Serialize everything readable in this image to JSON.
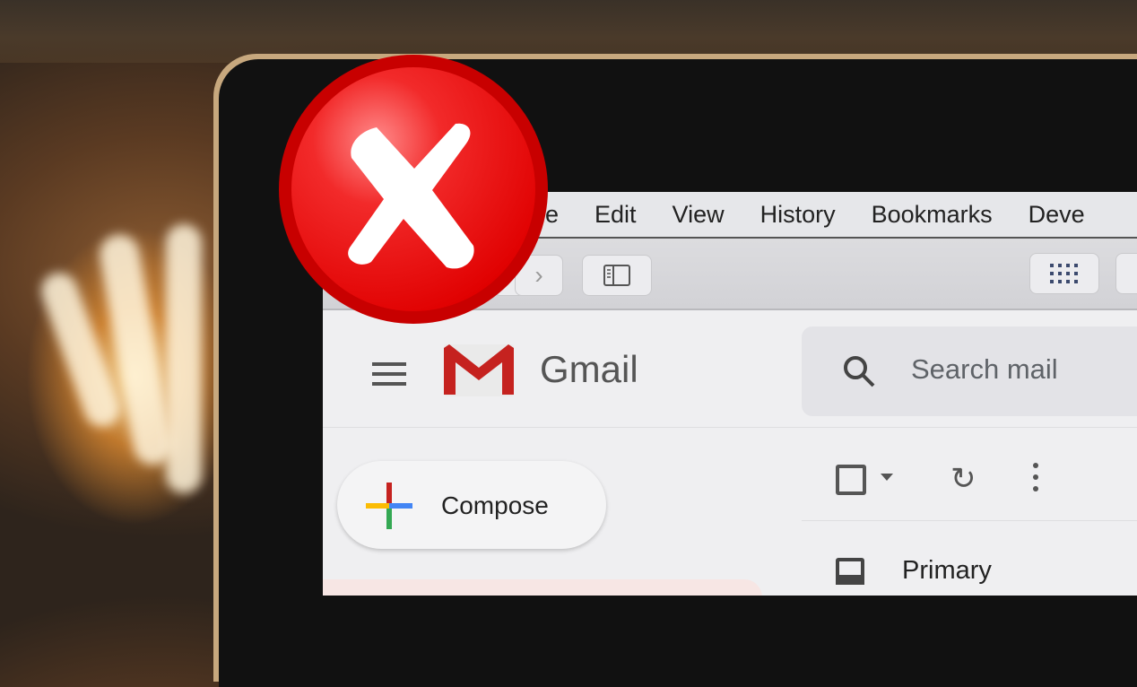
{
  "browser": {
    "menu": [
      "File",
      "Edit",
      "View",
      "History",
      "Bookmarks",
      "Deve"
    ],
    "visible_first_menu_fragment": "ile",
    "toolbar_icons": [
      "back-chevron-icon",
      "forward-chevron-icon",
      "sidebar-toggle-icon",
      "apps-grid-icon"
    ]
  },
  "gmail": {
    "brand": "Gmail",
    "search_placeholder": "Search mail",
    "compose_label": "Compose",
    "tab_primary": "Primary",
    "colors": {
      "red": "#c5221f",
      "blue": "#4285f4",
      "green": "#34a853",
      "yellow": "#fbbc04"
    }
  },
  "overlay": {
    "icon": "error-x-icon",
    "color": "#e00000"
  }
}
